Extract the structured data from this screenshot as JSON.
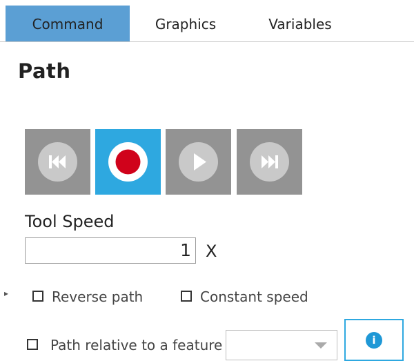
{
  "tabs": [
    {
      "label": "Command",
      "active": true
    },
    {
      "label": "Graphics",
      "active": false
    },
    {
      "label": "Variables",
      "active": false
    }
  ],
  "page": {
    "title": "Path"
  },
  "playback": {
    "buttons": [
      {
        "name": "rewind",
        "icon": "skip-back-icon",
        "active": false
      },
      {
        "name": "record",
        "icon": "record-icon",
        "active": true
      },
      {
        "name": "play",
        "icon": "play-icon",
        "active": false
      },
      {
        "name": "forward",
        "icon": "skip-forward-icon",
        "active": false
      }
    ],
    "colors": {
      "inactive": "#939393",
      "active": "#2ea8e0",
      "record": "#d0021b"
    }
  },
  "tool_speed": {
    "label": "Tool Speed",
    "value": "1",
    "unit": "X"
  },
  "options": {
    "reverse_path": {
      "label": "Reverse path",
      "checked": false
    },
    "constant_speed": {
      "label": "Constant speed",
      "checked": false
    },
    "relative_feature": {
      "label": "Path relative to a feature",
      "checked": false,
      "selected": ""
    }
  },
  "info": {
    "icon": "info-icon",
    "glyph": "i"
  }
}
